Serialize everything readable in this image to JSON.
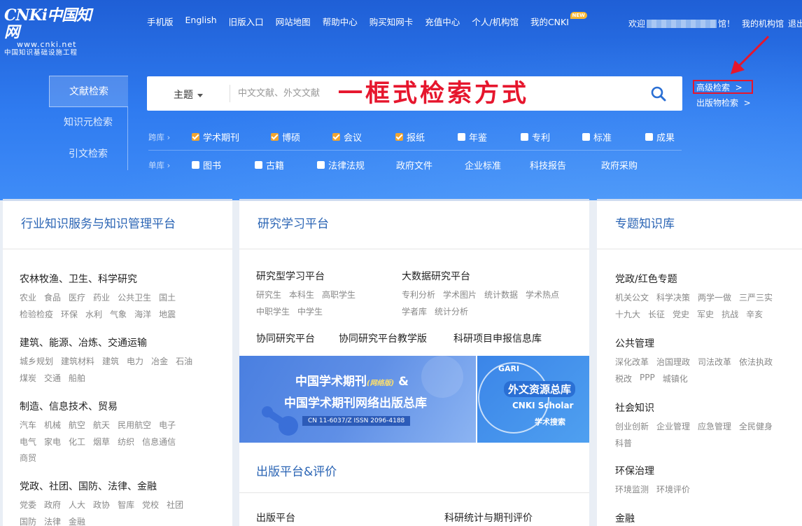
{
  "logo": {
    "main": "CNKi中国知网",
    "url": "www.cnki.net",
    "sub": "中国知识基础设施工程"
  },
  "topnav": [
    "手机版",
    "English",
    "旧版入口",
    "网站地图",
    "帮助中心",
    "购买知网卡",
    "充值中心",
    "个人/机构馆",
    "我的CNKI"
  ],
  "new_badge": "NEW",
  "user": {
    "welcome": "欢迎",
    "suffix": "馆！",
    "my_org": "我的机构馆",
    "logout": "退出"
  },
  "side_tabs": [
    "文献检索",
    "知识元检索",
    "引文检索"
  ],
  "search": {
    "field": "主题",
    "placeholder": "中文文献、外文文献",
    "annotation": "一框式检索方式"
  },
  "advanced": {
    "adv_label": "高级检索",
    "pub_label": "出版物检索",
    "chev": ">"
  },
  "cross_db": {
    "label": "跨库 ›",
    "options": [
      "学术期刊",
      "博硕",
      "会议",
      "报纸",
      "年鉴",
      "专利",
      "标准",
      "成果"
    ]
  },
  "single_db": {
    "label": "单库 ›",
    "options": [
      "图书",
      "古籍",
      "法律法规",
      "政府文件",
      "企业标准",
      "科技报告",
      "政府采购"
    ]
  },
  "left_card": {
    "title": "行业知识服务与知识管理平台",
    "groups": [
      {
        "title": "农林牧渔、卫生、科学研究",
        "lines": [
          [
            "农业",
            "食品",
            "医疗",
            "药业",
            "公共卫生",
            "国土"
          ],
          [
            "检验检疫",
            "环保",
            "水利",
            "气象",
            "海洋",
            "地震"
          ]
        ]
      },
      {
        "title": "建筑、能源、冶炼、交通运输",
        "lines": [
          [
            "城乡规划",
            "建筑材料",
            "建筑",
            "电力",
            "冶金",
            "石油"
          ],
          [
            "煤炭",
            "交通",
            "船舶"
          ]
        ]
      },
      {
        "title": "制造、信息技术、贸易",
        "lines": [
          [
            "汽车",
            "机械",
            "航空",
            "航天",
            "民用航空",
            "电子"
          ],
          [
            "电气",
            "家电",
            "化工",
            "烟草",
            "纺织",
            "信息通信"
          ],
          [
            "商贸"
          ]
        ]
      },
      {
        "title": "党政、社团、国防、法律、金融",
        "lines": [
          [
            "党委",
            "政府",
            "人大",
            "政协",
            "智库",
            "党校",
            "社团"
          ],
          [
            "国防",
            "法律",
            "金融"
          ]
        ]
      }
    ]
  },
  "mid_card": {
    "title": "研究学习平台",
    "g1": {
      "title": "研究型学习平台",
      "lines": [
        [
          "研究生",
          "本科生",
          "高职学生"
        ],
        [
          "中职学生",
          "中学生"
        ]
      ]
    },
    "g2": {
      "title": "大数据研究平台",
      "lines": [
        [
          "专利分析",
          "学术图片",
          "统计数据",
          "学术热点"
        ],
        [
          "学者库",
          "统计分析"
        ]
      ]
    },
    "links": [
      "协同研究平台",
      "协同研究平台教学版",
      "科研项目申报信息库"
    ],
    "banner": {
      "l1": "中国学术期刊",
      "l1_small": "(网络版)",
      "l1_amp": "&",
      "l2": "中国学术期刊网络出版总库",
      "l3": "CN 11-6037/Z   ISSN 2096-4188",
      "r1": "GARI",
      "r2": "外文资源总库",
      "r3": "CNKI Scholar",
      "r4": "学术搜索"
    },
    "pub_title": "出版平台&评价",
    "pub_links": [
      "出版平台",
      "科研统计与期刊评价"
    ]
  },
  "right_card": {
    "title": "专题知识库",
    "groups": [
      {
        "title": "党政/红色专题",
        "lines": [
          [
            "机关公文",
            "科学决策",
            "两学一做",
            "三严三实"
          ],
          [
            "十九大",
            "长征",
            "党史",
            "军史",
            "抗战",
            "辛亥"
          ]
        ]
      },
      {
        "title": "公共管理",
        "lines": [
          [
            "深化改革",
            "治国理政",
            "司法改革",
            "依法执政"
          ],
          [
            "税改",
            "PPP",
            "城镇化"
          ]
        ]
      },
      {
        "title": "社会知识",
        "lines": [
          [
            "创业创新",
            "企业管理",
            "应急管理",
            "全民健身"
          ],
          [
            "科普"
          ]
        ]
      },
      {
        "title": "环保治理",
        "lines": [
          [
            "环境监测",
            "环境评价"
          ]
        ]
      },
      {
        "title": "金融",
        "lines": []
      }
    ]
  },
  "colors": {
    "hero": "#2f7bf0",
    "accent_orange": "#f3a52d",
    "annotation_red": "#e6162d",
    "link_blue": "#2a64b4"
  }
}
